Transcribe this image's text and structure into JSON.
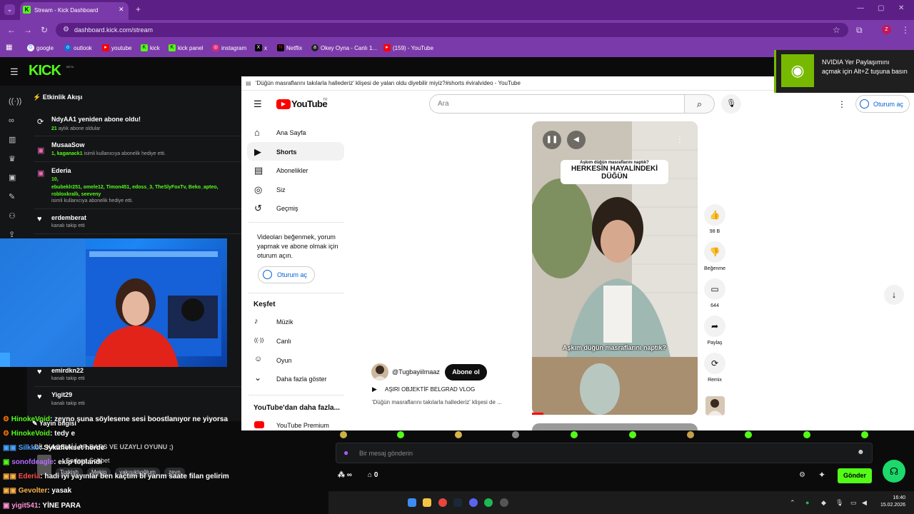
{
  "browser": {
    "tab_title": "Stream - Kick Dashboard",
    "url": "dashboard.kick.com/stream",
    "profile_initial": "Z",
    "bookmarks": [
      "google",
      "outlook",
      "youtube",
      "kick",
      "kick panel",
      "instagram",
      "x",
      "Netflix",
      "Okey Oyna - Canlı 1...",
      "(159) - YouTube"
    ]
  },
  "kick": {
    "logo": "KICK",
    "beta": "BETA",
    "feed_title": "Etkinlik Akışı",
    "events": [
      {
        "title": "NdyAA1 yeniden abone oldu!",
        "highlight": "21",
        "sub": " aylık abone oldular"
      },
      {
        "title": "MusaaSow",
        "highlight": "1, kaganack1",
        "sub": " isimli kullanıcıya abonelik hediye etti."
      },
      {
        "title": "Ederia",
        "highlight": "10,",
        "highlight2": "ebubeklr251, omele12, Timon451, edoss_3, TheSlyFoxTv, Beko_apteo, robloxkrallı, seeveny",
        "sub": "isimli kullanıcıya abonelik hediye etti."
      },
      {
        "title": "erdemberat",
        "sub": "kanalı takip etti"
      },
      {
        "title": "emirdkn22",
        "sub": "kanalı takip etti"
      },
      {
        "title": "Yigit29",
        "sub": "kanalı takip etti"
      }
    ],
    "overlay_text": {
      "stream_info": "Yayın bilgisi",
      "title_fragment": "DİL KAOSU İ.İ AR BARS VE UZAYLI OYUNU ;)",
      "sohbet": "Sadece Sohbet",
      "tags": [
        "Turkish",
        "Mekip",
        "yakışıklıoğlum",
        "zeyn"
      ]
    },
    "chat": [
      {
        "name": "HinokeVoid",
        "msg": ": zeyno şuna söylesene sesi boostlanıyor ne yiyorsa",
        "color": "#53fc18"
      },
      {
        "name": "HinokeVoid",
        "msg": ": tedy e",
        "color": "#53fc18"
      },
      {
        "name": "Silkko",
        "msg": ": Sykaflekset herde",
        "color": "#4aa3ff"
      },
      {
        "name": "sonofdeagle",
        "msg": ": ekip toplandı",
        "color": "#b46cff"
      },
      {
        "name": "Ederia",
        "msg": ": hadi iyi yayınlar ben kaçtım bi yarım saate filan gelirim",
        "color": "#ff4d4d"
      },
      {
        "name": "Gevolter",
        "msg": ": yasak",
        "color": "#ffb347"
      },
      {
        "name": "yigit541",
        "msg": ": YİNE PARA",
        "color": "#ff8fd1"
      }
    ],
    "chat_placeholder": "Bir mesaj gönderin",
    "points_value": "∞",
    "store_value": "0",
    "send_label": "Gönder"
  },
  "youtube": {
    "window_title": "'Düğün masraflarını takılarla hallederiz' klişesi de yalan oldu diyebilir miyiz?#shorts #viralvideo - YouTube",
    "logo_text": "YouTube",
    "logo_tr": "TR",
    "search_placeholder": "Ara",
    "signin_label": "Oturum aç",
    "sidebar": [
      {
        "icon": "⌂",
        "label": "Ana Sayfa"
      },
      {
        "icon": "▶",
        "label": "Shorts"
      },
      {
        "icon": "▤",
        "label": "Abonelikler"
      },
      {
        "icon": "◎",
        "label": "Siz"
      },
      {
        "icon": "↺",
        "label": "Geçmiş"
      }
    ],
    "signin_prompt": "Videoları beğenmek, yorum yapmak ve abone olmak için oturum açın.",
    "explore_title": "Keşfet",
    "explore": [
      {
        "icon": "♪",
        "label": "Müzik"
      },
      {
        "icon": "((·))",
        "label": "Canlı"
      },
      {
        "icon": "☺",
        "label": "Oyun"
      },
      {
        "icon": "⌄",
        "label": "Daha fazla göster"
      }
    ],
    "more_from_yt": "YouTube'dan daha fazla...",
    "premium": "YouTube Premium",
    "short": {
      "cap_top_small": "Aşkım düğün masraflarını naptık?",
      "cap_top_big": "HERKESİN HAYALİNDEKİ DÜĞÜN",
      "cap_bottom": "Aşkım düğün masraflarını naptık?",
      "channel": "@Tugbayiilmaaz",
      "subscribe": "Abone ol",
      "music": "AŞIRI OBJEKTİF BELGRAD VLOG",
      "description": "'Düğün masraflarını takılarla hallederiz' klişesi de ...",
      "progress_fraction": 0.07
    },
    "actions": [
      {
        "icon": "👍",
        "label": "98 B"
      },
      {
        "icon": "👎",
        "label": "Beğenme"
      },
      {
        "icon": "▭",
        "label": "644"
      },
      {
        "icon": "➦",
        "label": "Paylaş"
      },
      {
        "icon": "⟳",
        "label": "Remix"
      }
    ]
  },
  "nvidia": {
    "text": "NVIDIA Yer Paylaşımını açmak için Alt+Z tuşuna basın"
  },
  "taskbar": {
    "time": "16:40",
    "date": "15.02.2026"
  },
  "colors": {
    "kick_green": "#53fc18",
    "chrome_purple": "#7b3aa9",
    "youtube_red": "#ff0000",
    "nvidia_green": "#76b900"
  }
}
